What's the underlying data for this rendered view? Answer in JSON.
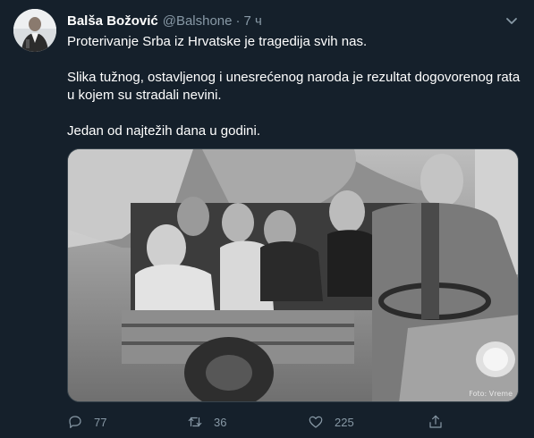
{
  "author": {
    "name": "Balša Božović",
    "handle": "@Balshone",
    "separator": "·",
    "time": "7 ч"
  },
  "tweet": {
    "paragraphs": [
      "Proterivanje Srba iz Hrvatske je tragedija svih nas.",
      "Slika tužnog, ostavljenog i unesrećenog naroda je rezultat dogovorenog rata u kojem su stradali nevini.",
      "Jedan od najtežih dana u godini."
    ]
  },
  "media": {
    "credit": "Foto: Vreme"
  },
  "actions": {
    "replies": "77",
    "retweets": "36",
    "likes": "225"
  },
  "icons": {
    "more": "chevron-down-icon",
    "reply": "reply-icon",
    "retweet": "retweet-icon",
    "like": "heart-icon",
    "share": "share-icon"
  },
  "colors": {
    "background": "#15202b",
    "secondary_text": "#8899a6",
    "primary_text": "#ffffff"
  }
}
